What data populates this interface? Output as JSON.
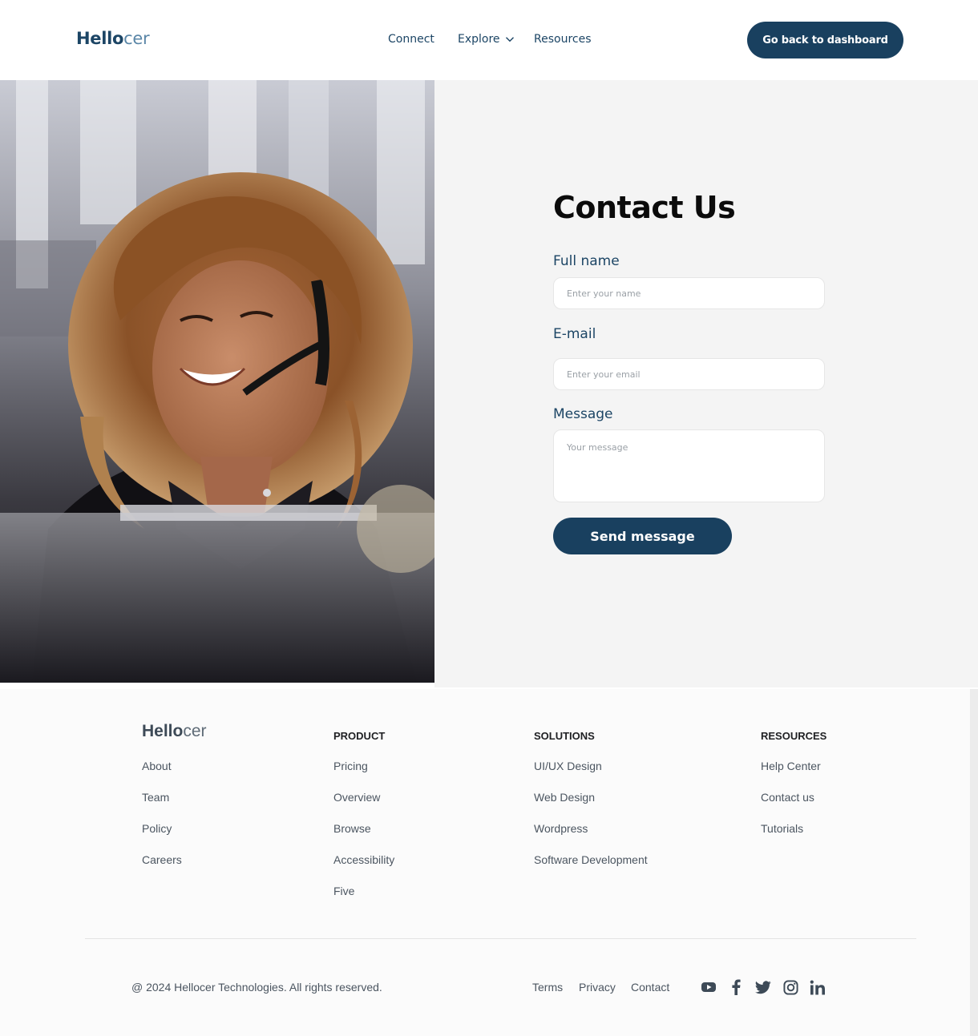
{
  "header": {
    "logo_bold": "Hello",
    "logo_light": "cer",
    "nav": {
      "connect": "Connect",
      "explore": "Explore",
      "resources": "Resources"
    },
    "dashboard_button": "Go back to dashboard"
  },
  "contact": {
    "title": "Contact Us",
    "fields": {
      "name_label": "Full name",
      "name_placeholder": "Enter your name",
      "email_label": "E-mail",
      "email_placeholder": "Enter your email",
      "message_label": "Message",
      "message_placeholder": "Your message"
    },
    "send_button": "Send message"
  },
  "footer": {
    "logo_bold": "Hello",
    "logo_light": "cer",
    "about_links": [
      "About",
      "Team",
      "Policy",
      "Careers"
    ],
    "product": {
      "heading": "PRODUCT",
      "links": [
        "Pricing",
        "Overview",
        "Browse",
        "Accessibility",
        "Five"
      ]
    },
    "solutions": {
      "heading": "SOLUTIONS",
      "links": [
        "UI/UX Design",
        "Web Design",
        "Wordpress",
        "Software Development"
      ]
    },
    "resources": {
      "heading": "RESOURCES",
      "links": [
        "Help Center",
        "Contact us",
        "Tutorials"
      ]
    },
    "copyright": "@ 2024 Hellocer Technologies. All rights reserved.",
    "bottom_links": {
      "terms": "Terms",
      "privacy": "Privacy",
      "contact": "Contact"
    },
    "social_icons": [
      "youtube-icon",
      "facebook-icon",
      "twitter-icon",
      "instagram-icon",
      "linkedin-icon"
    ]
  },
  "colors": {
    "brand_navy": "#19405f",
    "panel_bg": "#f4f4f4",
    "footer_bg": "#fbfbfb"
  }
}
